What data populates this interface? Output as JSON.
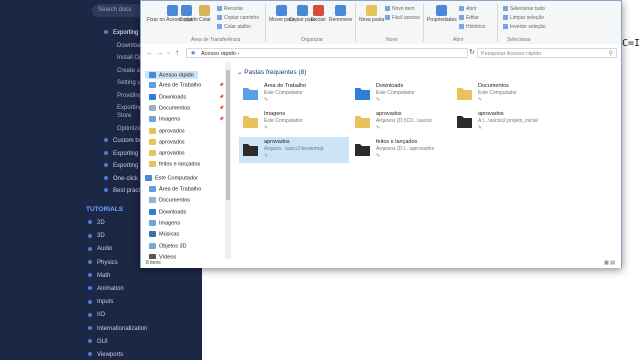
{
  "docs": {
    "search_placeholder": "Search docs",
    "items": [
      {
        "label": "Exporting p",
        "kind": "sel"
      },
      {
        "label": "Downloadi",
        "kind": "sub"
      },
      {
        "label": "Install Op",
        "kind": "sub"
      },
      {
        "label": "Create a",
        "kind": "sub"
      },
      {
        "label": "Setting u",
        "kind": "sub"
      },
      {
        "label": "Providing",
        "kind": "sub"
      },
      {
        "label": "Exporting",
        "kind": "sub"
      },
      {
        "label": "Store",
        "kind": "sub"
      },
      {
        "label": "Optimizin",
        "kind": "sub"
      },
      {
        "label": "Custom bu",
        "kind": "item"
      },
      {
        "label": "Exporting",
        "kind": "item"
      },
      {
        "label": "Exporting",
        "kind": "item"
      },
      {
        "label": "One-click",
        "kind": "item"
      },
      {
        "label": "Best practic",
        "kind": "item"
      }
    ],
    "tutorials_header": "TUTORIALS",
    "tutorials": [
      "2D",
      "3D",
      "Audio",
      "Physics",
      "Math",
      "Animation",
      "Inputs",
      "I/O",
      "Internationalization",
      "GUI",
      "Viewports"
    ]
  },
  "editor_text": "C=I",
  "ribbon": {
    "pin_label": "Fixar no Acesso rápido",
    "copy_label": "Copiar",
    "paste_label": "Colar",
    "cut_label": "Recortar",
    "copy_path_label": "Copiar caminho",
    "paste_shortcut_label": "Colar atalho",
    "group_clipboard": "Área de Transferência",
    "move_label": "Mover para",
    "copyto_label": "Copiar para",
    "delete_label": "Excluir",
    "rename_label": "Renomear",
    "group_organize": "Organizar",
    "newfolder_label": "Nova pasta",
    "newitem_label": "Novo item",
    "easyaccess_label": "Fácil acesso",
    "group_new": "Novo",
    "properties_label": "Propriedades",
    "open_label": "Abrir",
    "edit_label": "Editar",
    "history_label": "Histórico",
    "group_open": "Abrir",
    "selectall_label": "Selecionar tudo",
    "selectnone_label": "Limpar seleção",
    "invert_label": "Inverter seleção",
    "group_select": "Selecionar"
  },
  "address": {
    "path": "Acesso rápido",
    "search_placeholder": "Pesquisar Acesso rápido"
  },
  "nav": [
    {
      "label": "Acesso rápido",
      "icon": "star-icon",
      "sel": true
    },
    {
      "label": "Área de Trabalho",
      "icon": "desktop-icon",
      "pin": true
    },
    {
      "label": "Downloads",
      "icon": "download-icon",
      "pin": true
    },
    {
      "label": "Documentos",
      "icon": "documents-icon",
      "pin": true
    },
    {
      "label": "Imagens",
      "icon": "pictures-icon",
      "pin": true
    },
    {
      "label": "aprovados",
      "icon": "folder-icon"
    },
    {
      "label": "aprovados",
      "icon": "folder-icon"
    },
    {
      "label": "aprovados",
      "icon": "folder-icon"
    },
    {
      "label": "feitos e lançados",
      "icon": "folder-icon"
    },
    {
      "label": "Este Computador",
      "icon": "computer-icon"
    },
    {
      "label": "Área de Trabalho",
      "icon": "desktop-icon"
    },
    {
      "label": "Documentos",
      "icon": "documents-icon"
    },
    {
      "label": "Downloads",
      "icon": "download-icon"
    },
    {
      "label": "Imagens",
      "icon": "pictures-icon"
    },
    {
      "label": "Músicas",
      "icon": "music-icon"
    },
    {
      "label": "Objetos 3D",
      "icon": "objects3d-icon"
    },
    {
      "label": "Vídeos",
      "icon": "videos-icon"
    }
  ],
  "group_header": "Pastas frequentes (8)",
  "tiles": [
    {
      "name": "Área de Trabalho",
      "loc": "Este Computador",
      "icon": "desktop-folder-icon",
      "color": "#5aa0e6"
    },
    {
      "name": "Downloads",
      "loc": "Este Computador",
      "icon": "download-folder-icon",
      "color": "#2f7fd6"
    },
    {
      "name": "Documentos",
      "loc": "Este Computador",
      "icon": "documents-folder-icon",
      "color": "#e8c35a"
    },
    {
      "name": "Imagens",
      "loc": "Este Computador",
      "icon": "pictures-folder-icon",
      "color": "#e8c35a"
    },
    {
      "name": "aprovados",
      "loc": "Arquivos (D:)\\C0...\\sacoo",
      "icon": "folder-icon",
      "color": "#e8c35a"
    },
    {
      "name": "aprovados",
      "loc": "A:\\...\\sacoo2 projeto_inicial",
      "icon": "dark-folder-icon",
      "color": "#2b2b2b"
    },
    {
      "name": "aprovados",
      "loc": "Arquivo...\\saco3-bestemup",
      "icon": "dark-folder-icon",
      "color": "#2b2b2b",
      "sel": true
    },
    {
      "name": "feitos e lançados",
      "loc": "Arquivos (D:)...\\aprovados",
      "icon": "dark-folder-icon",
      "color": "#2b2b2b"
    }
  ],
  "status_count": "8 itens"
}
